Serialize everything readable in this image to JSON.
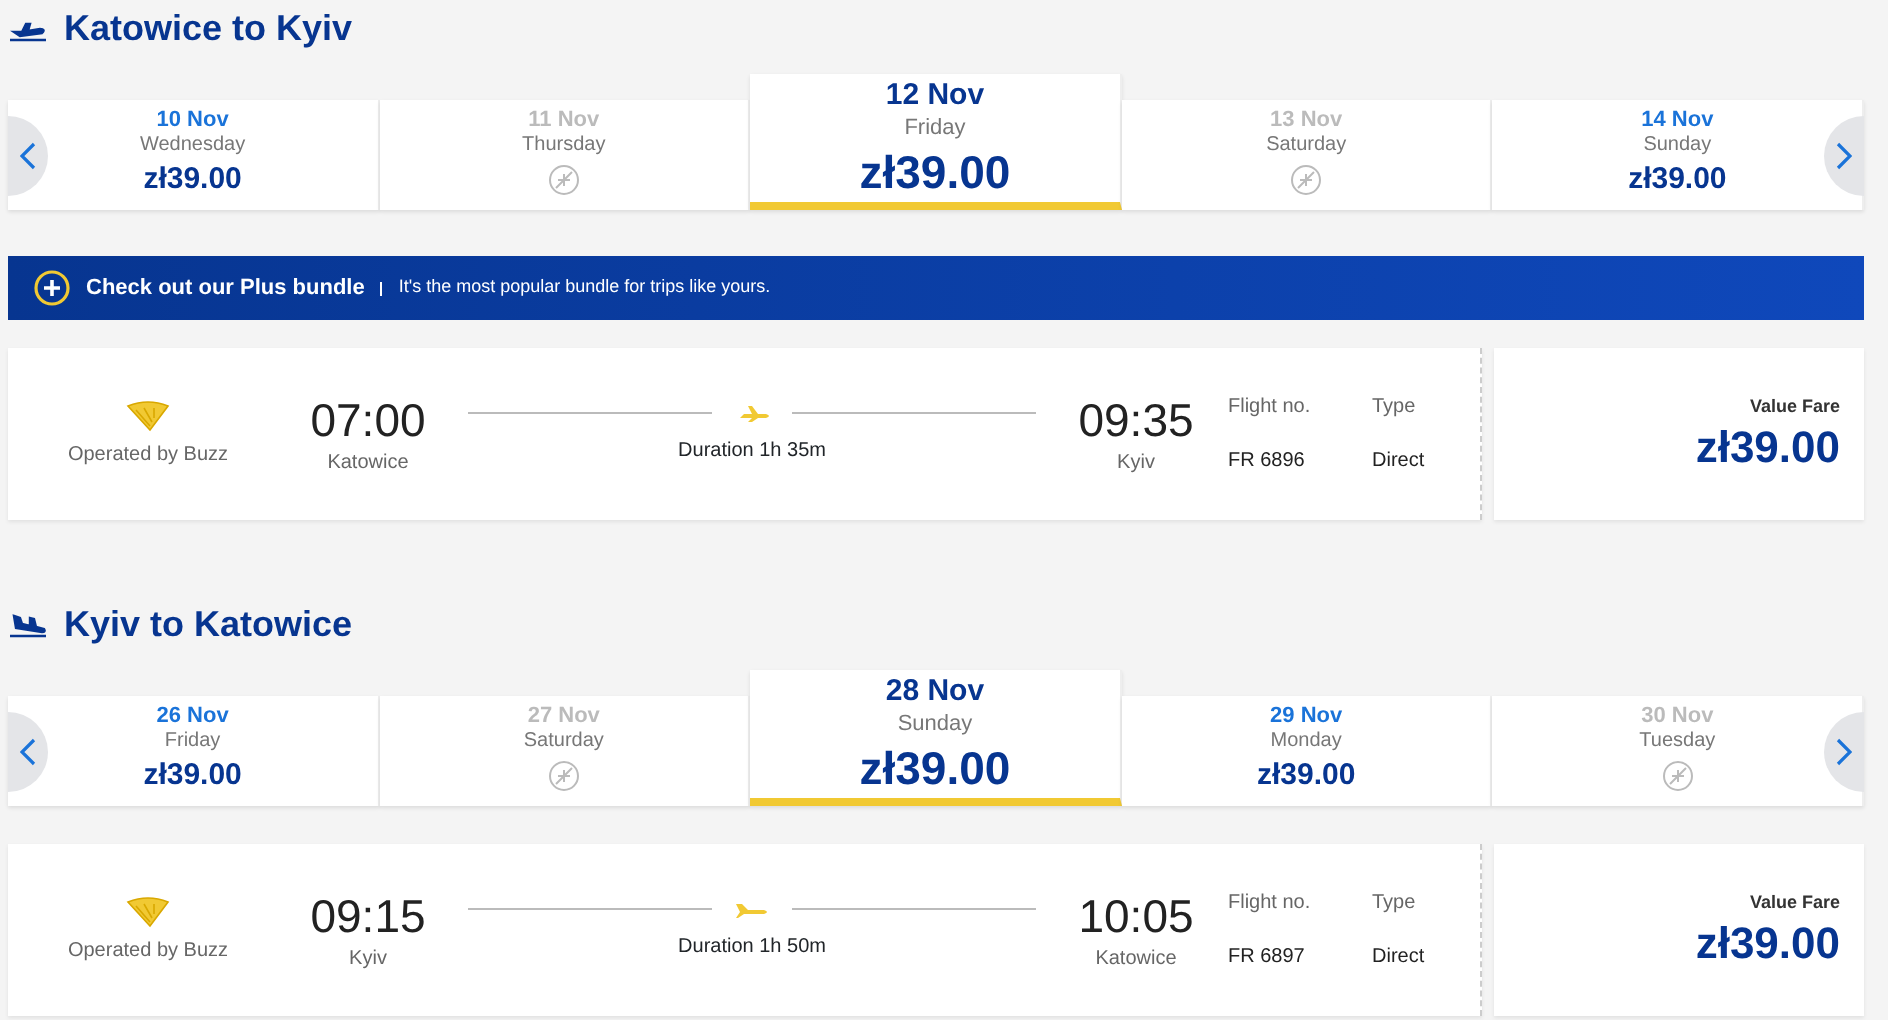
{
  "sections": [
    {
      "title": "Katowice to Kyiv",
      "kind": "outbound",
      "days": [
        {
          "date": "10 Nov",
          "weekday": "Wednesday",
          "price": "zł39.00",
          "available": true,
          "selected": false
        },
        {
          "date": "11 Nov",
          "weekday": "Thursday",
          "available": false,
          "selected": false
        },
        {
          "date": "12 Nov",
          "weekday": "Friday",
          "price": "zł39.00",
          "available": true,
          "selected": true
        },
        {
          "date": "13 Nov",
          "weekday": "Saturday",
          "available": false,
          "selected": false
        },
        {
          "date": "14 Nov",
          "weekday": "Sunday",
          "price": "zł39.00",
          "available": true,
          "selected": false
        }
      ],
      "banner": {
        "title": "Check out our Plus bundle",
        "text": "It's the most popular bundle for trips like yours."
      },
      "flight": {
        "operator": "Operated by Buzz",
        "depart_time": "07:00",
        "depart_city": "Katowice",
        "duration": "Duration 1h 35m",
        "arrive_time": "09:35",
        "arrive_city": "Kyiv",
        "flight_no_label": "Flight no.",
        "flight_no": "FR 6896",
        "type_label": "Type",
        "type": "Direct",
        "fare_label": "Value Fare",
        "fare": "zł39.00"
      }
    },
    {
      "title": "Kyiv to Katowice",
      "kind": "inbound",
      "days": [
        {
          "date": "26 Nov",
          "weekday": "Friday",
          "price": "zł39.00",
          "available": true,
          "selected": false
        },
        {
          "date": "27 Nov",
          "weekday": "Saturday",
          "available": false,
          "selected": false
        },
        {
          "date": "28 Nov",
          "weekday": "Sunday",
          "price": "zł39.00",
          "available": true,
          "selected": true
        },
        {
          "date": "29 Nov",
          "weekday": "Monday",
          "price": "zł39.00",
          "available": true,
          "selected": false
        },
        {
          "date": "30 Nov",
          "weekday": "Tuesday",
          "available": false,
          "selected": false
        }
      ],
      "flight": {
        "operator": "Operated by Buzz",
        "depart_time": "09:15",
        "depart_city": "Kyiv",
        "duration": "Duration 1h 50m",
        "arrive_time": "10:05",
        "arrive_city": "Katowice",
        "flight_no_label": "Flight no.",
        "flight_no": "FR 6897",
        "type_label": "Type",
        "type": "Direct",
        "fare_label": "Value Fare",
        "fare": "zł39.00"
      }
    }
  ]
}
